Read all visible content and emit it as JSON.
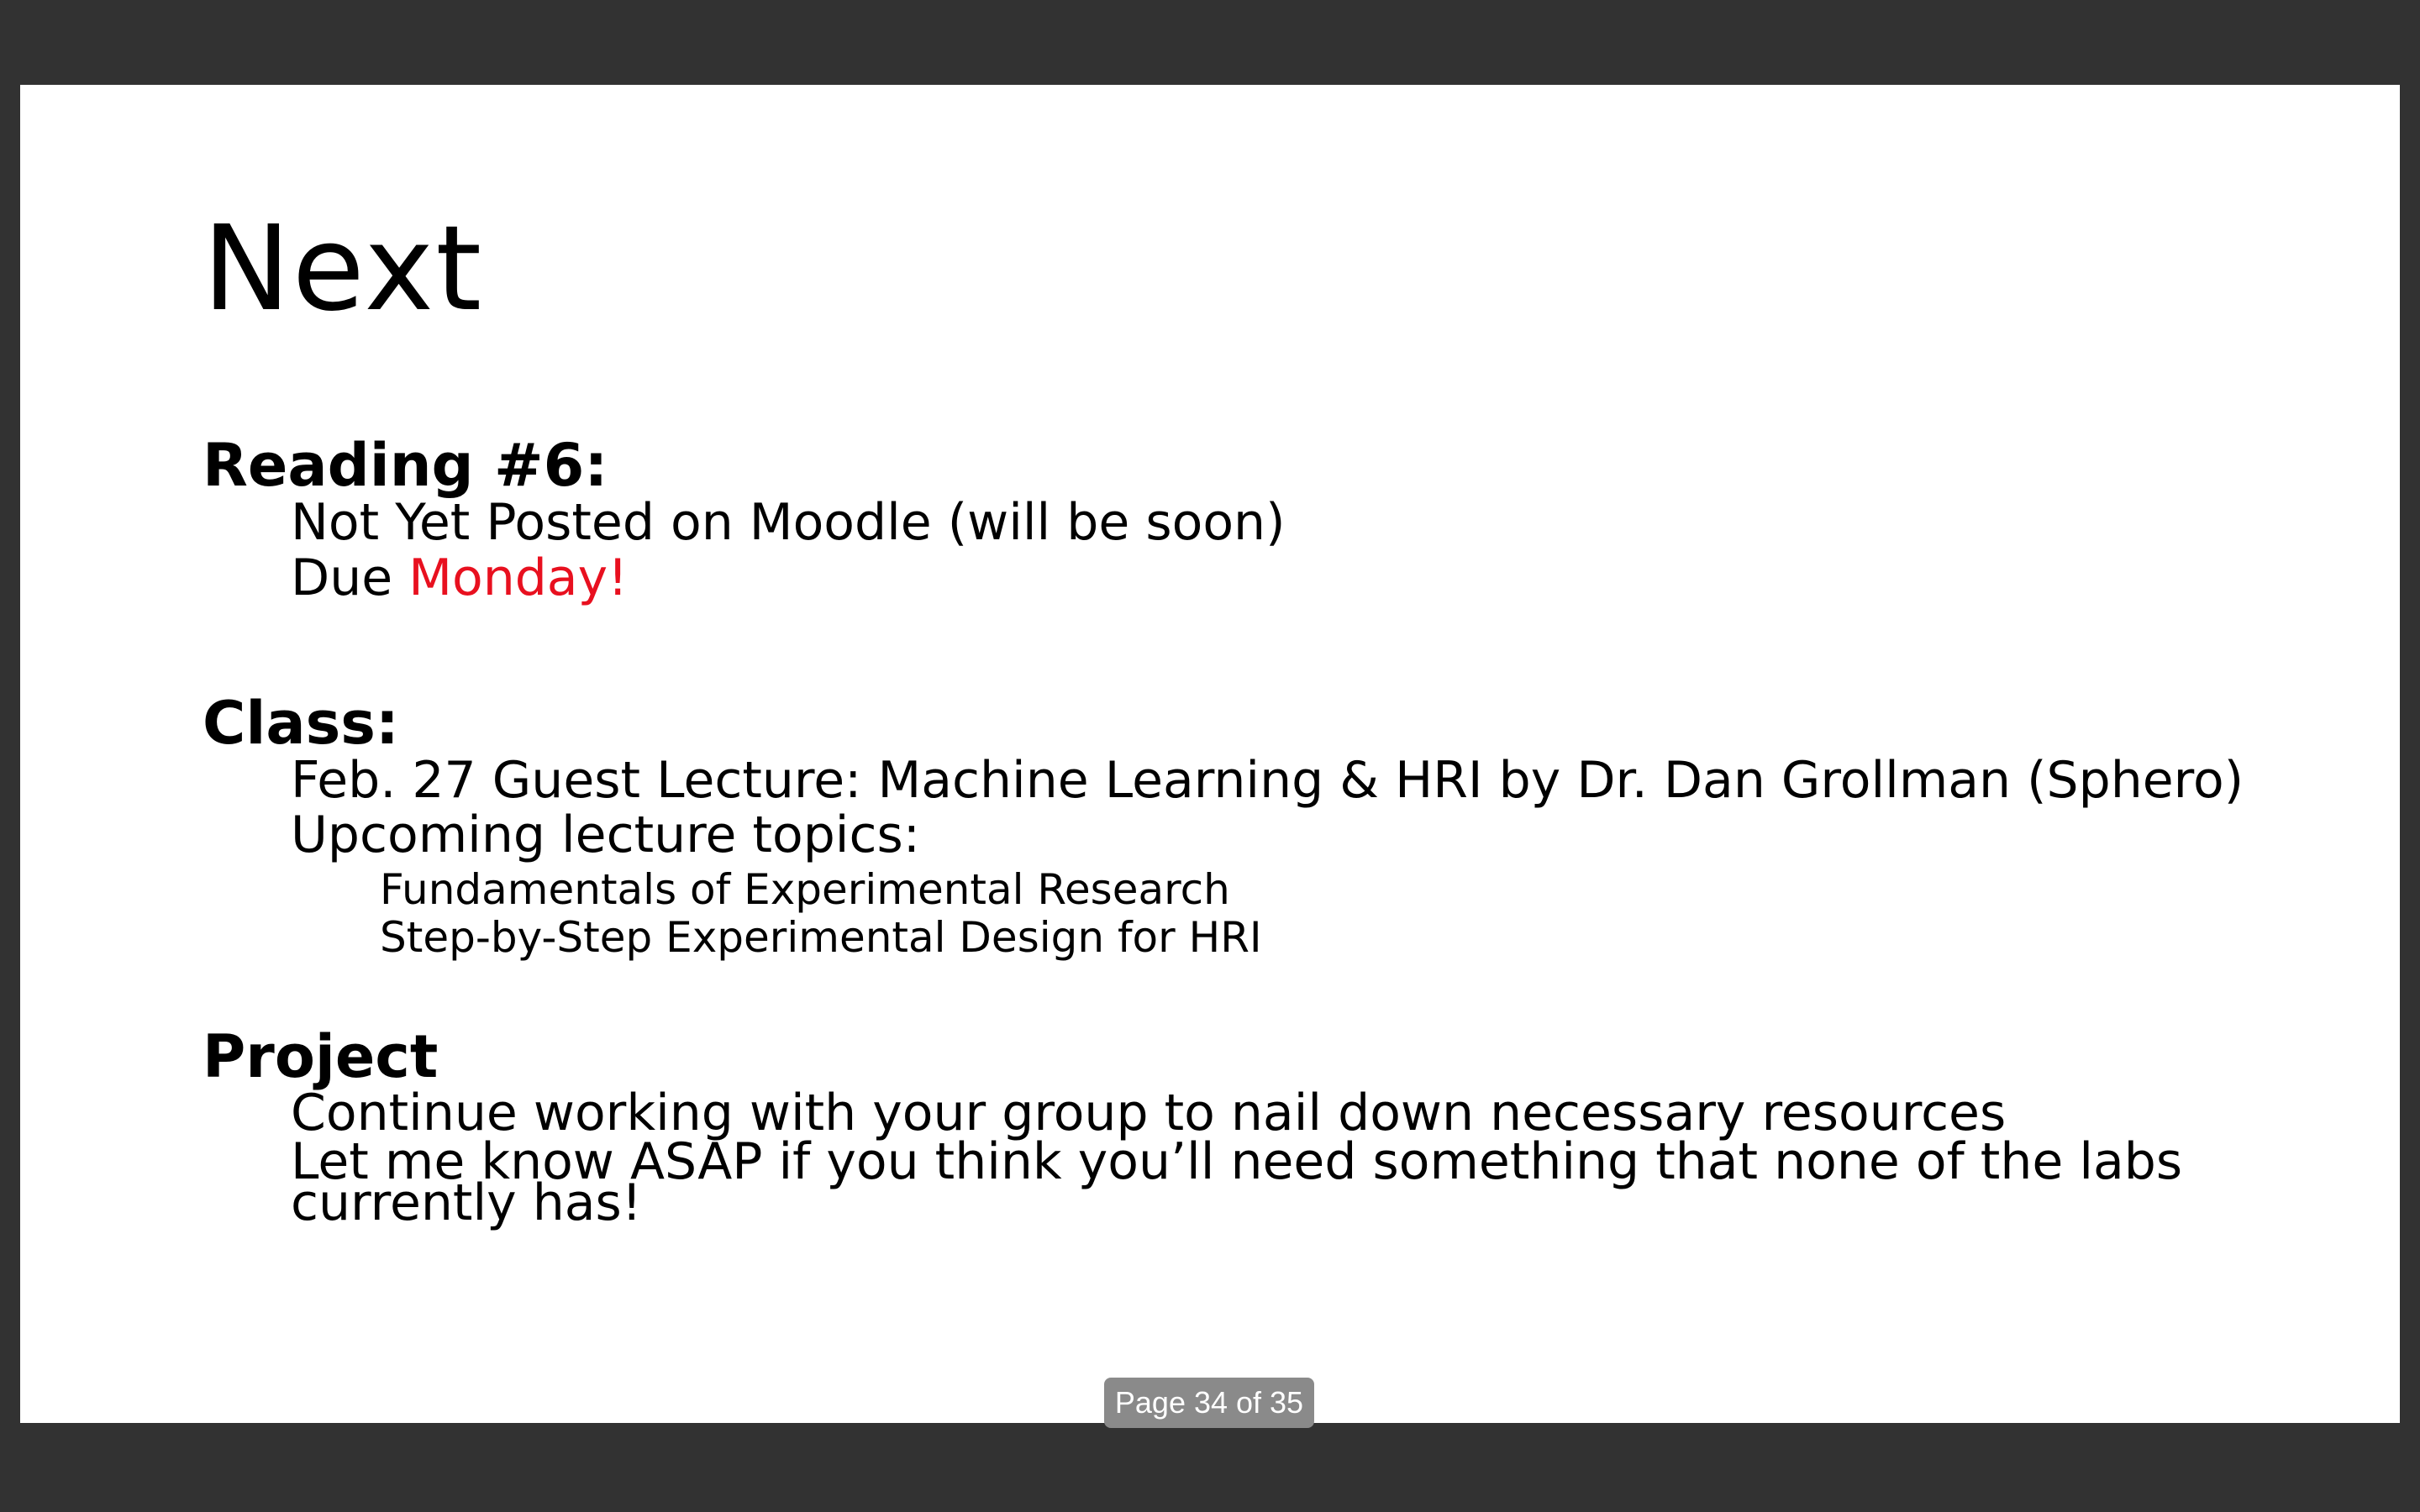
{
  "slide": {
    "title": "Next",
    "sections": {
      "reading": {
        "heading": "Reading #6:",
        "line1": "Not Yet Posted on Moodle (will be soon)",
        "due_prefix": "Due ",
        "due_day": "Monday!"
      },
      "class": {
        "heading": "Class:",
        "line1": "Feb. 27 Guest Lecture: Machine Learning & HRI by Dr. Dan Grollman (Sphero)",
        "line2": "Upcoming lecture topics:",
        "topics": [
          "Fundamentals of Experimental Research",
          "Step-by-Step Experimental Design for HRI"
        ]
      },
      "project": {
        "heading": "Project",
        "line1": "Continue working with your group to nail down necessary resources",
        "line2": "Let me know ASAP if you think you’ll need something that none of the labs currently has!"
      }
    }
  },
  "viewer": {
    "page_indicator": "Page 34 of 35"
  },
  "colors": {
    "background": "#323232",
    "slide": "#ffffff",
    "accent": "#e8101f",
    "indicator": "#8a8a8a"
  }
}
